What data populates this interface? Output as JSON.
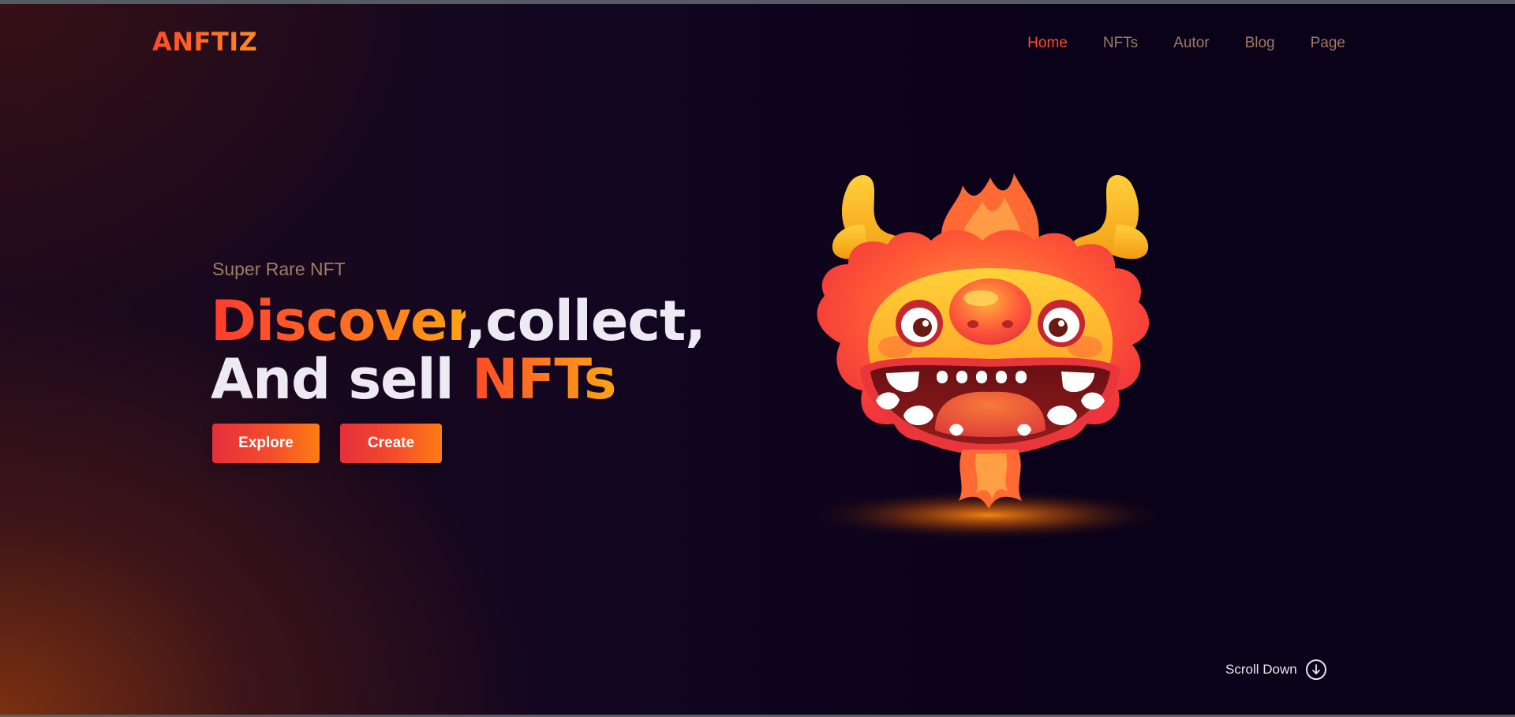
{
  "brand": {
    "logo_text": "ANFTIZ"
  },
  "nav": {
    "items": [
      {
        "label": "Home",
        "active": true
      },
      {
        "label": "NFTs",
        "active": false
      },
      {
        "label": "Autor",
        "active": false
      },
      {
        "label": "Blog",
        "active": false
      },
      {
        "label": "Page",
        "active": false
      }
    ]
  },
  "hero": {
    "subtitle": "Super Rare NFT",
    "headline_part1_highlight": "Discover",
    "headline_part1_rest": ",collect,",
    "headline_part2_plain": "And sell ",
    "headline_part2_highlight": "NFTs",
    "buttons": {
      "explore_label": "Explore",
      "create_label": "Create"
    },
    "image_icon": "fire-dragon-mascot"
  },
  "scroll": {
    "label": "Scroll Down",
    "icon": "arrow-down-circle-icon"
  },
  "colors": {
    "accent_start": "#ff3b2f",
    "accent_end": "#ffa312",
    "background": "#0b0419",
    "text_light": "#eeeaf4",
    "nav_muted": "#a07963",
    "nav_active": "#ff4a26"
  }
}
